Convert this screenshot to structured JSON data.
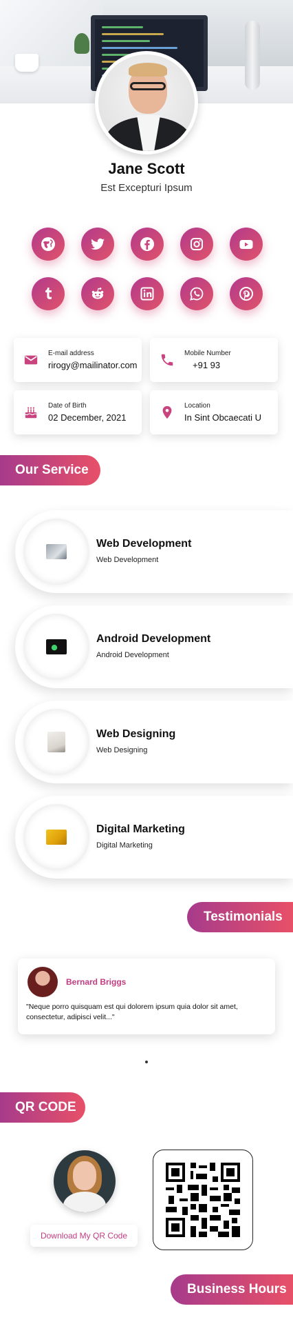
{
  "profile": {
    "name": "Jane Scott",
    "title": "Est Excepturi Ipsum"
  },
  "social": [
    {
      "name": "website",
      "icon": "globe-icon"
    },
    {
      "name": "twitter",
      "icon": "twitter-icon"
    },
    {
      "name": "facebook",
      "icon": "facebook-icon"
    },
    {
      "name": "instagram",
      "icon": "instagram-icon"
    },
    {
      "name": "youtube",
      "icon": "youtube-icon"
    },
    {
      "name": "tumblr",
      "icon": "tumblr-icon"
    },
    {
      "name": "reddit",
      "icon": "reddit-icon"
    },
    {
      "name": "linkedin",
      "icon": "linkedin-icon"
    },
    {
      "name": "whatsapp",
      "icon": "whatsapp-icon"
    },
    {
      "name": "pinterest",
      "icon": "pinterest-icon"
    }
  ],
  "contact": {
    "email": {
      "label": "E-mail address",
      "value": "rirogy@mailinator.com",
      "icon": "mail-icon"
    },
    "phone": {
      "label": "Mobile Number",
      "value": "+91 93",
      "icon": "phone-icon"
    },
    "dob": {
      "label": "Date of Birth",
      "value": "02 December, 2021",
      "icon": "cake-icon"
    },
    "location": {
      "label": "Location",
      "value": "In Sint Obcaecati U",
      "icon": "map-pin-icon"
    }
  },
  "services": {
    "heading": "Our Service",
    "items": [
      {
        "name": "Web Development",
        "description": "Web Development"
      },
      {
        "name": "Android Development",
        "description": "Android Development"
      },
      {
        "name": "Web Designing",
        "description": "Web Designing"
      },
      {
        "name": "Digital Marketing",
        "description": "Digital Marketing"
      }
    ]
  },
  "testimonials": {
    "heading": "Testimonials",
    "items": [
      {
        "author": "Bernard Briggs",
        "quote": "\"Neque porro quisquam est qui dolorem ipsum quia dolor sit amet, consectetur, adipisci velit...\""
      }
    ]
  },
  "qr": {
    "heading": "QR CODE",
    "download_label": "Download My QR Code"
  },
  "business_hours": {
    "heading": "Business Hours"
  },
  "colors": {
    "accent_start": "#a63b8b",
    "accent_end": "#e85068",
    "accent_text": "#c23c82"
  }
}
